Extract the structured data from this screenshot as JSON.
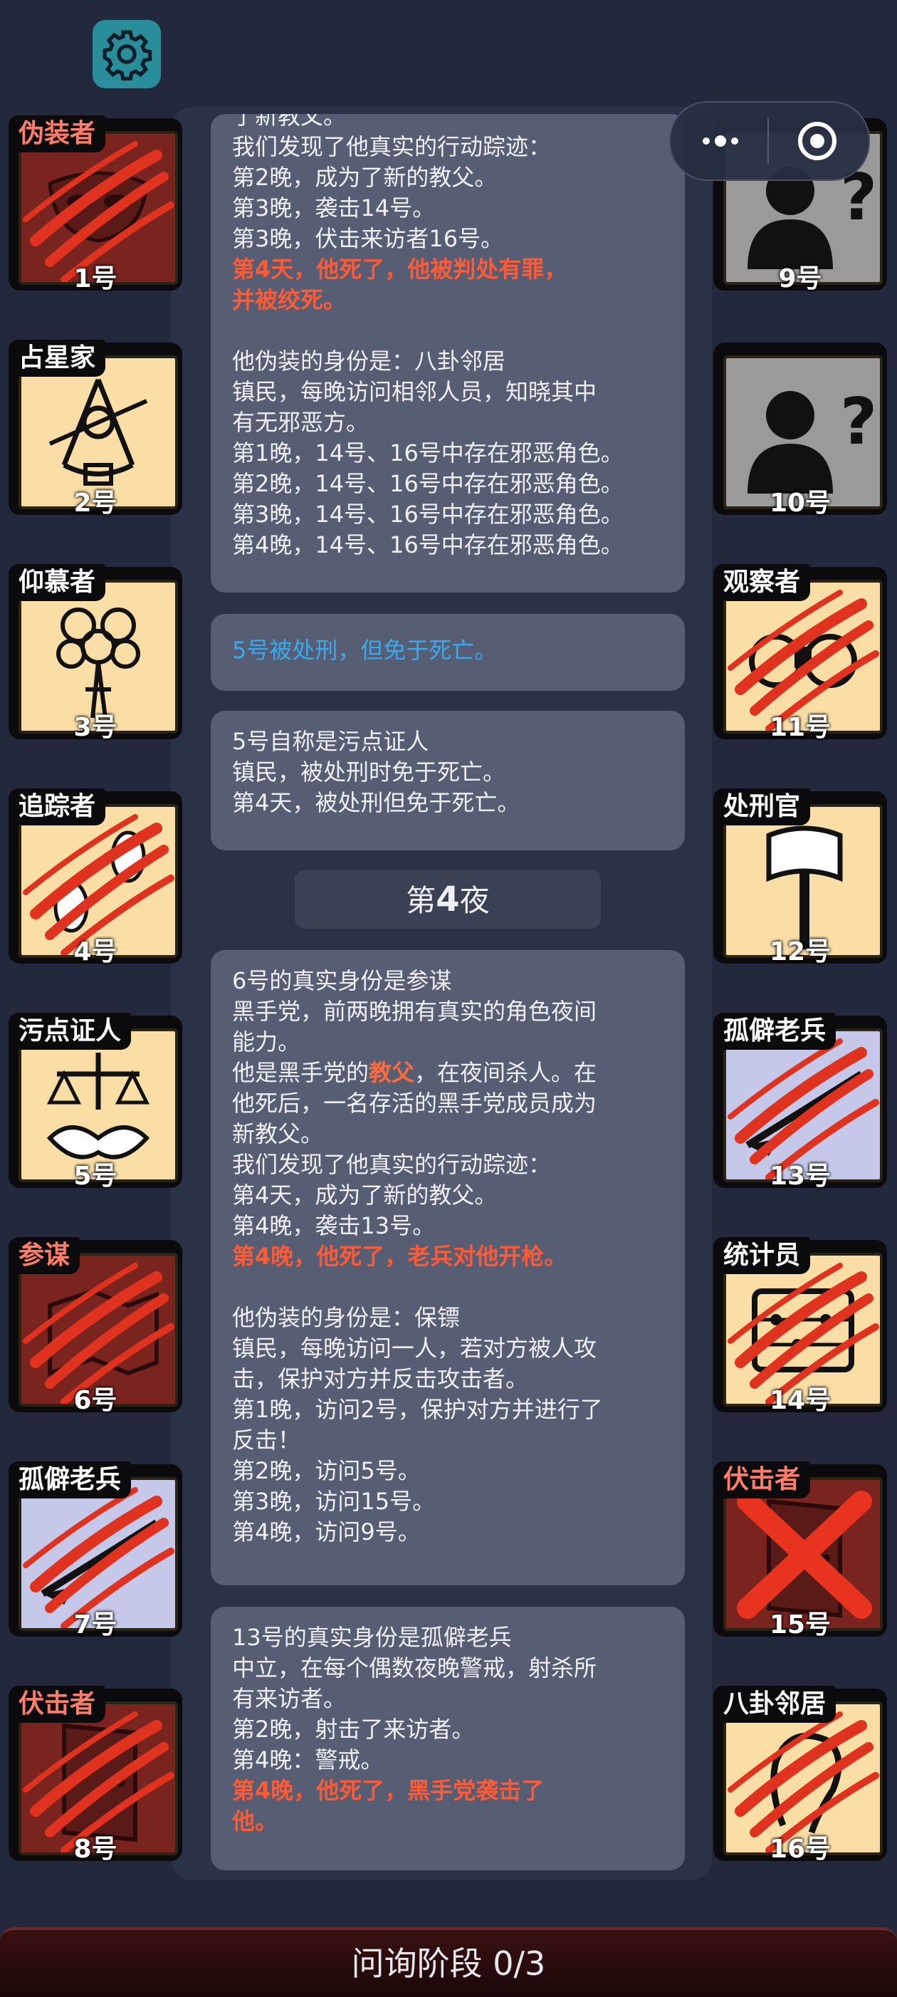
{
  "players_left": [
    {
      "label": "伪装者",
      "num": "1号",
      "color": "red",
      "bg": "#7a2420",
      "art": "mask",
      "dead": true
    },
    {
      "label": "占星家",
      "num": "2号",
      "color": "white",
      "bg": "#fbdda6",
      "art": "sextant",
      "dead": false
    },
    {
      "label": "仰慕者",
      "num": "3号",
      "color": "white",
      "bg": "#fbdda6",
      "art": "flowers",
      "dead": false
    },
    {
      "label": "追踪者",
      "num": "4号",
      "color": "white",
      "bg": "#fbdda6",
      "art": "footprints",
      "dead": true
    },
    {
      "label": "污点证人",
      "num": "5号",
      "color": "white",
      "bg": "#fbdda6",
      "art": "scales",
      "dead": false
    },
    {
      "label": "参谋",
      "num": "6号",
      "color": "red",
      "bg": "#7a2420",
      "art": "map",
      "dead": true
    },
    {
      "label": "孤僻老兵",
      "num": "7号",
      "color": "white",
      "bg": "#c6c8ea",
      "art": "rifle",
      "dead": true
    },
    {
      "label": "伏击者",
      "num": "8号",
      "color": "red",
      "bg": "#7a2420",
      "art": "door",
      "dead": true
    }
  ],
  "players_right": [
    {
      "label": "",
      "num": "9号",
      "color": "white",
      "bg": "#9a9a9a",
      "art": "unknown",
      "dead": false
    },
    {
      "label": "",
      "num": "10号",
      "color": "white",
      "bg": "#9a9a9a",
      "art": "unknown",
      "dead": false
    },
    {
      "label": "观察者",
      "num": "11号",
      "color": "white",
      "bg": "#fbdda6",
      "art": "binoculars",
      "dead": true
    },
    {
      "label": "处刑官",
      "num": "12号",
      "color": "white",
      "bg": "#fbdda6",
      "art": "axe",
      "dead": false
    },
    {
      "label": "孤僻老兵",
      "num": "13号",
      "color": "white",
      "bg": "#c6c8ea",
      "art": "rifle",
      "dead": true
    },
    {
      "label": "统计员",
      "num": "14号",
      "color": "white",
      "bg": "#fbdda6",
      "art": "abacus",
      "dead": true
    },
    {
      "label": "伏击者",
      "num": "15号",
      "color": "red",
      "bg": "#7a2420",
      "art": "door",
      "dead": false,
      "crossed": true
    },
    {
      "label": "八卦邻居",
      "num": "16号",
      "color": "white",
      "bg": "#fbdda6",
      "art": "ear",
      "dead": true
    }
  ],
  "log": [
    {
      "lines": [
        {
          "t": "了新教父。",
          "c": ""
        },
        {
          "t": "我们发现了他真实的行动踪迹：",
          "c": ""
        },
        {
          "t": "第2晚，成为了新的教父。",
          "c": ""
        },
        {
          "t": "第3晚，袭击14号。",
          "c": ""
        },
        {
          "t": "第3晚，伏击来访者16号。",
          "c": ""
        },
        {
          "t": "第4天，他死了，他被判处有罪，",
          "c": "hl"
        },
        {
          "t": "并被绞死。",
          "c": "hl"
        },
        {
          "t": " ",
          "c": ""
        },
        {
          "t": "他伪装的身份是：八卦邻居",
          "c": ""
        },
        {
          "t": "镇民，每晚访问相邻人员，知晓其中",
          "c": ""
        },
        {
          "t": "有无邪恶方。",
          "c": ""
        },
        {
          "t": "第1晚，14号、16号中存在邪恶角色。",
          "c": ""
        },
        {
          "t": "第2晚，14号、16号中存在邪恶角色。",
          "c": ""
        },
        {
          "t": "第3晚，14号、16号中存在邪恶角色。",
          "c": ""
        },
        {
          "t": "第4晚，14号、16号中存在邪恶角色。",
          "c": ""
        }
      ]
    },
    {
      "lines": [
        {
          "t": "5号被处刑，但免于死亡。",
          "c": "bl"
        }
      ]
    },
    {
      "lines": [
        {
          "t": "5号自称是污点证人",
          "c": ""
        },
        {
          "t": "镇民，被处刑时免于死亡。",
          "c": ""
        },
        {
          "t": "第4天，被处刑但免于死亡。",
          "c": ""
        }
      ]
    },
    {
      "lines": [
        {
          "t": "6号的真实身份是参谋",
          "c": ""
        },
        {
          "t": "黑手党，前两晚拥有真实的角色夜间",
          "c": ""
        },
        {
          "t": "能力。",
          "c": ""
        },
        {
          "pre": "他是黑手党的",
          "em": "教父",
          "post": "，在夜间杀人。在",
          "c": "mix"
        },
        {
          "t": "他死后，一名存活的黑手党成员成为",
          "c": ""
        },
        {
          "t": "新教父。",
          "c": ""
        },
        {
          "t": "我们发现了他真实的行动踪迹：",
          "c": ""
        },
        {
          "t": "第4天，成为了新的教父。",
          "c": ""
        },
        {
          "t": "第4晚，袭击13号。",
          "c": ""
        },
        {
          "t": "第4晚，他死了，老兵对他开枪。",
          "c": "hl"
        },
        {
          "t": " ",
          "c": ""
        },
        {
          "t": "他伪装的身份是：保镖",
          "c": ""
        },
        {
          "t": "镇民，每晚访问一人，若对方被人攻",
          "c": ""
        },
        {
          "t": "击，保护对方并反击攻击者。",
          "c": ""
        },
        {
          "t": "第1晚，访问2号，保护对方并进行了",
          "c": ""
        },
        {
          "t": "反击！",
          "c": ""
        },
        {
          "t": "第2晚，访问5号。",
          "c": ""
        },
        {
          "t": "第3晚，访问15号。",
          "c": ""
        },
        {
          "t": "第4晚，访问9号。",
          "c": ""
        }
      ]
    },
    {
      "lines": [
        {
          "t": "13号的真实身份是孤僻老兵",
          "c": ""
        },
        {
          "t": "中立，在每个偶数夜晚警戒，射杀所",
          "c": ""
        },
        {
          "t": "有来访者。",
          "c": ""
        },
        {
          "t": "第2晚，射击了来访者。",
          "c": ""
        },
        {
          "t": "第4晚：警戒。",
          "c": ""
        },
        {
          "t": "第4晚，他死了，黑手党袭击了",
          "c": "hl"
        },
        {
          "t": "他。",
          "c": "hl"
        }
      ]
    }
  ],
  "night": {
    "prefix": "第",
    "number": "4",
    "suffix": "夜"
  },
  "bottom_bar": "问询阶段 0/3",
  "colors": {
    "claw": "#e0331f",
    "accent_red": "#ff5a36",
    "blue_text": "#37aaf0",
    "teal_button": "#2a8d9a"
  }
}
